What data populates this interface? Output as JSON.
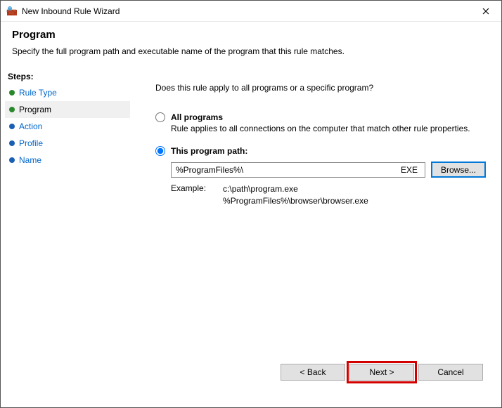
{
  "window": {
    "title": "New Inbound Rule Wizard"
  },
  "header": {
    "title": "Program",
    "subtitle": "Specify the full program path and executable name of the program that this rule matches."
  },
  "sidebar": {
    "heading": "Steps:",
    "steps": [
      {
        "label": "Rule Type",
        "state": "done",
        "link": true
      },
      {
        "label": "Program",
        "state": "current",
        "link": false
      },
      {
        "label": "Action",
        "state": "pending",
        "link": true
      },
      {
        "label": "Profile",
        "state": "pending",
        "link": true
      },
      {
        "label": "Name",
        "state": "pending",
        "link": true
      }
    ]
  },
  "main": {
    "prompt": "Does this rule apply to all programs or a specific program?",
    "options": {
      "all": {
        "label": "All programs",
        "desc": "Rule applies to all connections on the computer that match other rule properties."
      },
      "path": {
        "label": "This program path:",
        "value": "%ProgramFiles%\\",
        "ext": "EXE"
      }
    },
    "browse": "Browse...",
    "example_label": "Example:",
    "example_line1": "c:\\path\\program.exe",
    "example_line2": "%ProgramFiles%\\browser\\browser.exe"
  },
  "footer": {
    "back": "< Back",
    "next": "Next >",
    "cancel": "Cancel"
  }
}
